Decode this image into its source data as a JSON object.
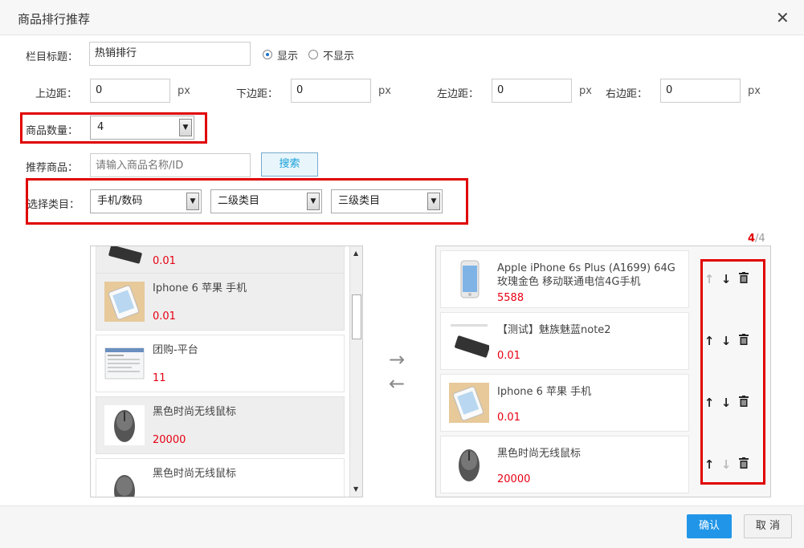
{
  "dialog": {
    "title": "商品排行推荐",
    "close": "✕"
  },
  "form": {
    "column_title_label": "栏目标题：",
    "column_title_value": "热销排行",
    "show_label": "显示",
    "hide_label": "不显示",
    "top_margin_label": "上边距：",
    "top_margin_value": "0",
    "bottom_margin_label": "下边距：",
    "bottom_margin_value": "0",
    "left_margin_label": "左边距：",
    "left_margin_value": "0",
    "right_margin_label": "右边距：",
    "right_margin_value": "0",
    "unit": "px",
    "count_label": "商品数量：",
    "count_value": "4",
    "recommend_label": "推荐商品：",
    "search_placeholder": "请输入商品名称/ID",
    "search_button": "搜索",
    "category_label": "选择类目：",
    "category1": "手机/数码",
    "category2": "二级类目",
    "category3": "三级类目"
  },
  "counter": {
    "selected": "4",
    "total": "/4"
  },
  "left_list": [
    {
      "name": "",
      "price": "0.01",
      "selected": true,
      "thumb": "tablet"
    },
    {
      "name": "Iphone 6 苹果 手机",
      "price": "0.01",
      "selected": true,
      "thumb": "phone-hand"
    },
    {
      "name": "团购-平台",
      "price": "11",
      "selected": false,
      "thumb": "screenshot"
    },
    {
      "name": "黑色时尚无线鼠标",
      "price": "20000",
      "selected": true,
      "thumb": "mouse"
    },
    {
      "name": "黑色时尚无线鼠标",
      "price": "",
      "selected": false,
      "thumb": "mouse"
    }
  ],
  "right_list": [
    {
      "name": "Apple iPhone 6s Plus (A1699) 64G 玫瑰金色 移动联通电信4G手机",
      "price": "5588",
      "thumb": "iphone"
    },
    {
      "name": "【测试】魅族魅蓝note2",
      "price": "0.01",
      "thumb": "tablet"
    },
    {
      "name": "Iphone 6 苹果 手机",
      "price": "0.01",
      "thumb": "phone-hand"
    },
    {
      "name": "黑色时尚无线鼠标",
      "price": "20000",
      "thumb": "mouse"
    }
  ],
  "icons": {
    "arrow_right": "→",
    "arrow_left": "←",
    "up": "↑",
    "down": "↓",
    "delete": "trash-icon"
  },
  "footer": {
    "confirm": "确认",
    "cancel": "取 消"
  },
  "colors": {
    "price": "#e60012",
    "confirm": "#2196e8",
    "highlight": "#e00000"
  }
}
